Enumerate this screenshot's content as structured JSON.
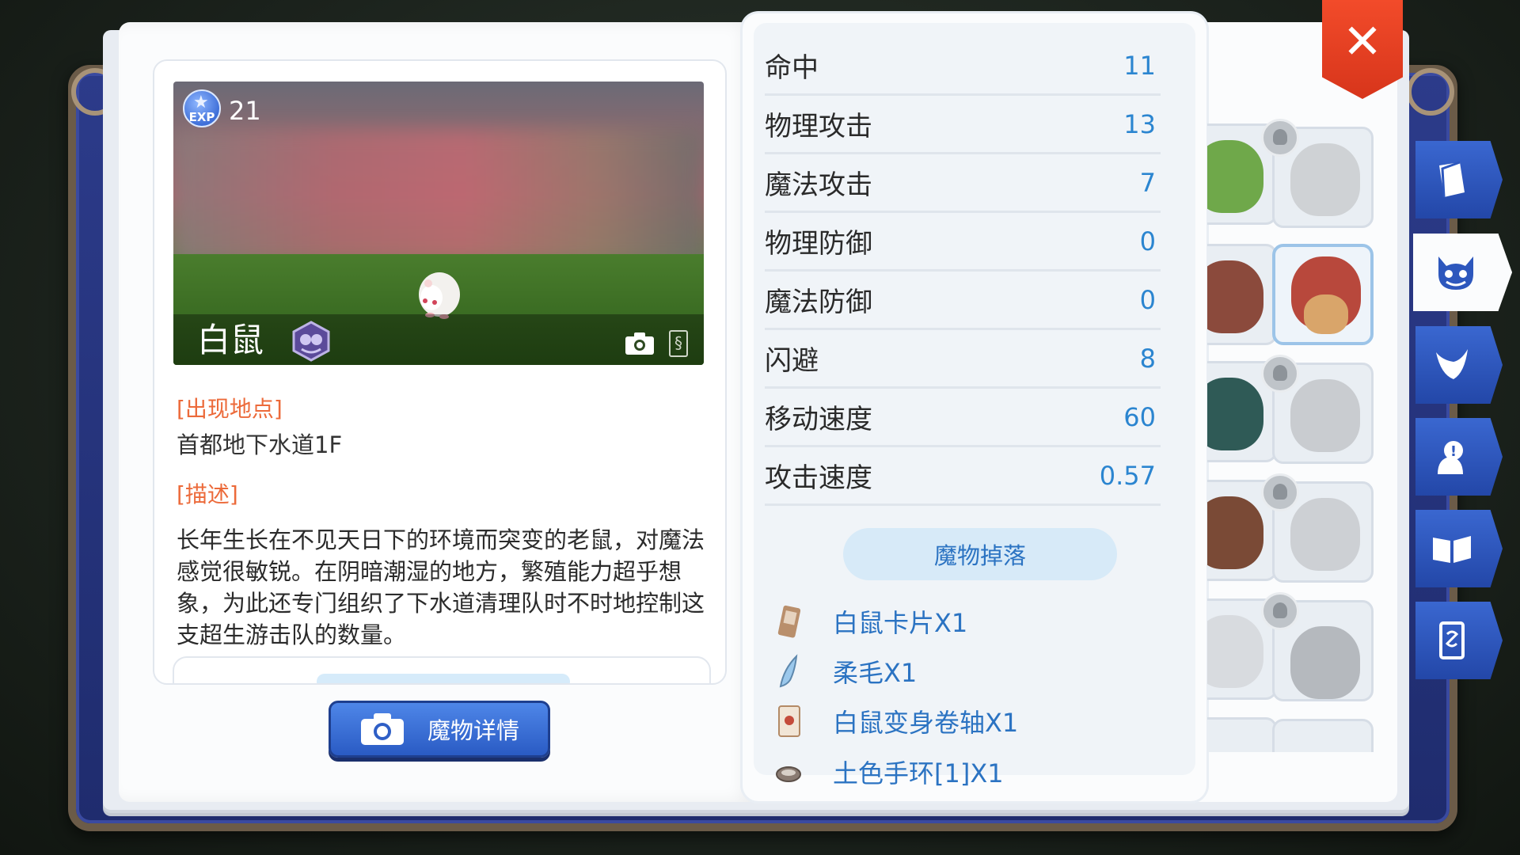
{
  "monster": {
    "exp_label": "EXP",
    "exp_value": "21",
    "name": "白鼠",
    "location_title": "[出现地点]",
    "location": "首都地下水道1F",
    "desc_title": "[描述]",
    "description": "长年生长在不见天日下的环境而突变的老鼠，对魔法感觉很敏锐。在阴暗潮湿的地方，繁殖能力超乎想象，为此还专门组织了下水道清理队时不时地控制这支超生游击队的数量。",
    "details_button": "魔物详情"
  },
  "stats": [
    {
      "label": "命中",
      "value": "11"
    },
    {
      "label": "物理攻击",
      "value": "13"
    },
    {
      "label": "魔法攻击",
      "value": "7"
    },
    {
      "label": "物理防御",
      "value": "0"
    },
    {
      "label": "魔法防御",
      "value": "0"
    },
    {
      "label": "闪避",
      "value": "8"
    },
    {
      "label": "移动速度",
      "value": "60"
    },
    {
      "label": "攻击速度",
      "value": "0.57"
    }
  ],
  "drops": {
    "button": "魔物掉落",
    "items": [
      {
        "label": "白鼠卡片X1",
        "icon": "card-icon"
      },
      {
        "label": "柔毛X1",
        "icon": "fur-icon"
      },
      {
        "label": "白鼠变身卷轴X1",
        "icon": "scroll-icon"
      },
      {
        "label": "土色手环[1]X1",
        "icon": "bracelet-icon"
      }
    ]
  },
  "side_tabs": [
    "book-icon",
    "monster-face-icon",
    "horn-icon",
    "npc-icon",
    "open-book-icon",
    "card-icon"
  ],
  "colors": {
    "accent_blue": "#2b85d0",
    "section_orange": "#ec6a3a",
    "close_red": "#e2401f",
    "tab_blue": "#2d57bd"
  }
}
